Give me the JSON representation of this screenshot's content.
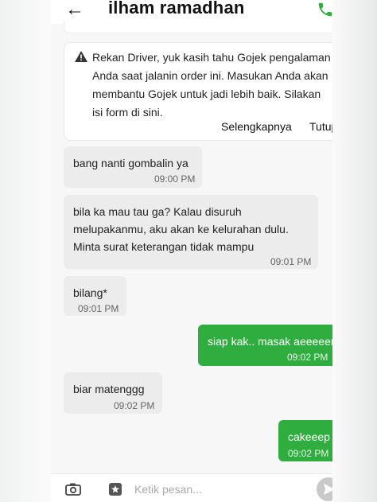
{
  "header": {
    "title": "ilham ramadhan",
    "back_icon": "arrow-left-icon",
    "call_icon": "phone-icon"
  },
  "notice": {
    "icon": "warning-icon",
    "text": "Rekan Driver, yuk kasih tahu Gojek pengalaman Anda saat jalanin order ini. Masukan Anda akan membantu Gojek untuk jadi lebih baik. Silakan isi form di sini.",
    "more_label": "Selengkapnya",
    "close_label": "Tutup"
  },
  "messages": [
    {
      "direction": "incoming",
      "text": "bang nanti gombalin ya",
      "time": "09:00 PM"
    },
    {
      "direction": "incoming",
      "text": "bila ka mau tau ga? Kalau disuruh melupakanmu, aku akan ke kelurahan dulu. Minta surat keterangan tidak mampu",
      "time": "09:01 PM"
    },
    {
      "direction": "incoming",
      "text": "bilang*",
      "time": "09:01 PM"
    },
    {
      "direction": "outgoing",
      "text": "siap kak.. masak aeeeeerr",
      "time": "09:02 PM"
    },
    {
      "direction": "incoming",
      "text": "biar matenggg",
      "time": "09:02 PM"
    },
    {
      "direction": "outgoing",
      "text": "cakeeep",
      "time": "09:02 PM"
    }
  ],
  "composer": {
    "placeholder": "Ketik pesan...",
    "camera_icon": "camera-icon",
    "sticker_icon": "sticker-icon",
    "send_icon": "send-icon"
  },
  "colors": {
    "accent": "#2fae3f",
    "incoming_bubble": "#ececec",
    "background": "#f7f7f7"
  }
}
